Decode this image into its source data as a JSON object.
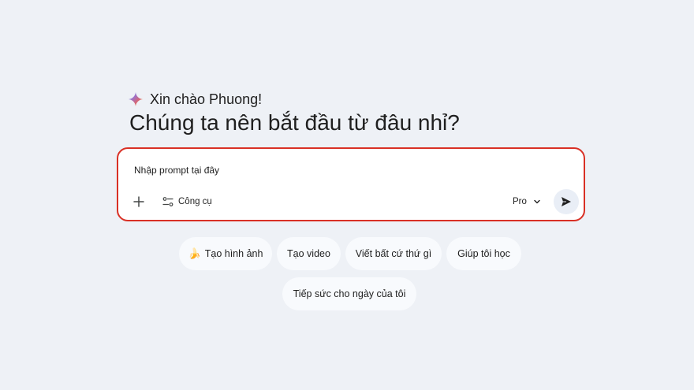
{
  "greeting": {
    "text": "Xin chào Phuong!",
    "icon": "gemini-spark-icon"
  },
  "headline": "Chúng ta nên bắt đầu từ đâu nhỉ?",
  "prompt": {
    "placeholder": "Nhập prompt tại đây",
    "value": "",
    "add_icon": "plus-icon",
    "tools_icon": "tools-sliders-icon",
    "tools_label": "Công cụ",
    "model_label": "Pro",
    "model_icon": "chevron-down-icon",
    "send_icon": "send-icon",
    "highlight_color": "#d93025"
  },
  "chips": [
    {
      "label": "Tạo hình ảnh",
      "icon": "banana-icon"
    },
    {
      "label": "Tạo video"
    },
    {
      "label": "Viết bất cứ thứ gì"
    },
    {
      "label": "Giúp tôi học"
    },
    {
      "label": "Tiếp sức cho ngày của tôi"
    }
  ],
  "colors": {
    "background": "#eef1f6",
    "card": "#ffffff",
    "chip": "#f8fafd",
    "send_button": "#e9eef6"
  }
}
